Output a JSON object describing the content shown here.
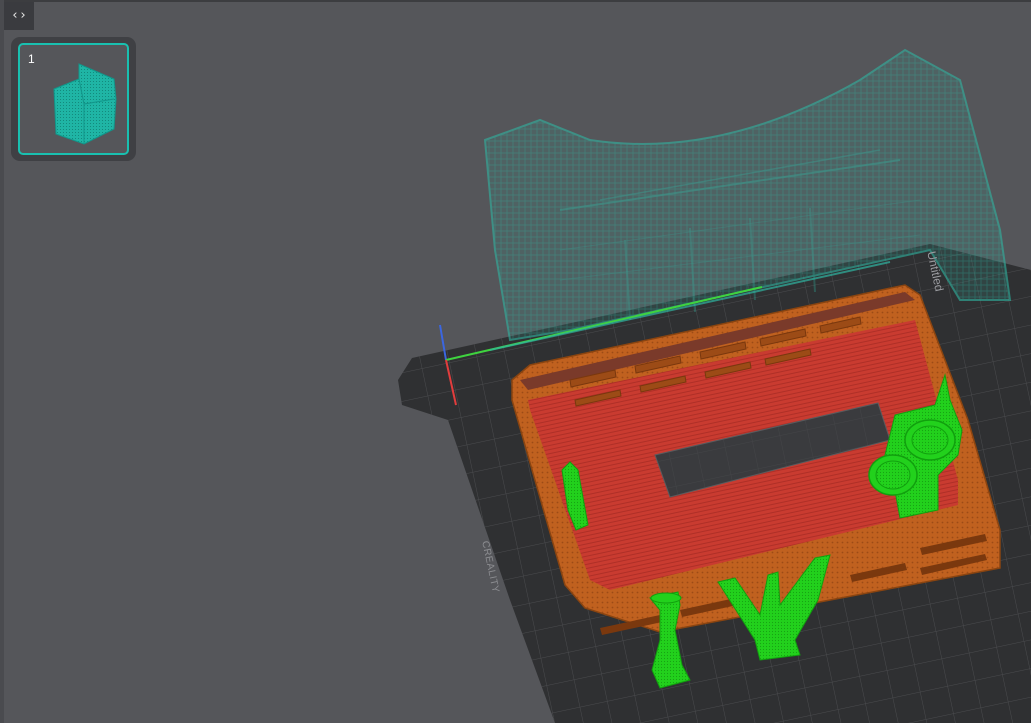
{
  "toolbar": {
    "collapse_glyph": "‹›"
  },
  "plate_list": {
    "items": [
      {
        "number": "1",
        "icon": "model-thumbnail-icon"
      }
    ]
  },
  "plate": {
    "name": "Untitled",
    "brand": "CREALITY"
  },
  "colors": {
    "background": "#55565a",
    "plate": "#2f3032",
    "grid": "#4a4b4e",
    "walls": "#c0611f",
    "floor": "#c93b30",
    "supports": "#22d11c",
    "ghost": "#2fb5a2",
    "selection": "#19c0b0",
    "axis_x": "#e23d3d",
    "axis_y": "#3fd33f",
    "axis_z": "#3b66e0"
  }
}
